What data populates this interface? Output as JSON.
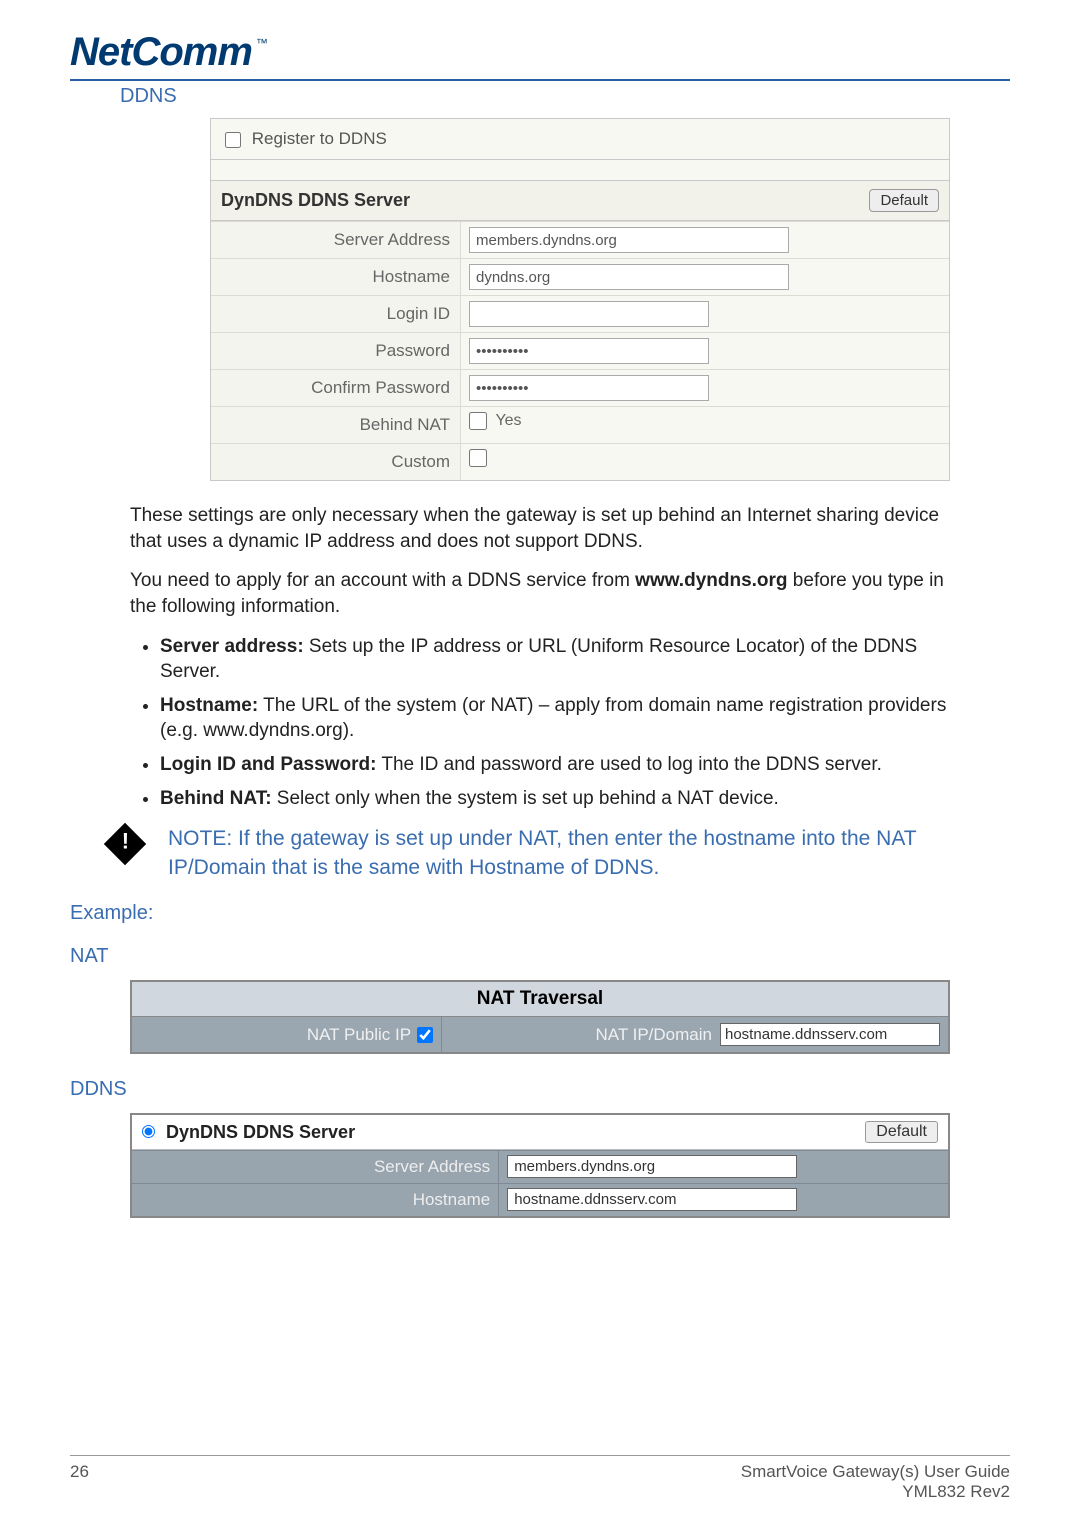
{
  "logo": "NetComm",
  "tm": "™",
  "sections": {
    "ddns_heading": "DDNS",
    "register_label": "Register to DDNS",
    "server_title": "DynDNS DDNS Server",
    "default_btn": "Default",
    "fields": {
      "server_address": {
        "label": "Server Address",
        "value": "members.dyndns.org"
      },
      "hostname": {
        "label": "Hostname",
        "value": "dyndns.org"
      },
      "login_id": {
        "label": "Login ID",
        "value": ""
      },
      "password": {
        "label": "Password",
        "value": "••••••••••"
      },
      "confirm_password": {
        "label": "Confirm Password",
        "value": "••••••••••"
      },
      "behind_nat": {
        "label": "Behind NAT",
        "yes": "Yes"
      },
      "custom": {
        "label": "Custom"
      }
    }
  },
  "para1": "These settings are only necessary when the gateway is set up behind an Internet sharing device that uses a dynamic IP address and does not support DDNS.",
  "para2a": "You need to apply for an account with a DDNS service from ",
  "para2b": "www.dyndns.org",
  "para2c": " before you type in the following information.",
  "bullets": {
    "b1a": "Server address:",
    "b1b": " Sets up the IP address or URL (Uniform Resource Locator) of the DDNS Server.",
    "b2a": "Hostname:",
    "b2b": " The URL of the system (or NAT) – apply from domain name registration providers (e.g. www.dyndns.org).",
    "b3a": "Login ID and Password:",
    "b3b": " The ID and password are used to log into the DDNS server.",
    "b4a": "Behind NAT:",
    "b4b": " Select only when the system is set up behind a NAT device."
  },
  "note_label": "NOTE:",
  "note_text": " If the gateway is set up under NAT, then enter the hostname into the NAT IP/Domain that is the same with Hostname of DDNS.",
  "example_label": "Example:",
  "nat_heading": "NAT",
  "nat_table": {
    "title": "NAT Traversal",
    "left_label": "NAT Public IP",
    "right_label": "NAT IP/Domain",
    "right_value": "hostname.ddnsserv.com"
  },
  "ddns2_heading": "DDNS",
  "ddns2": {
    "title": "DynDNS DDNS Server",
    "default_btn": "Default",
    "server_address": {
      "label": "Server Address",
      "value": "members.dyndns.org"
    },
    "hostname": {
      "label": "Hostname",
      "value": "hostname.ddnsserv.com"
    }
  },
  "footer": {
    "page": "26",
    "guide": "SmartVoice Gateway(s) User Guide",
    "rev": "YML832 Rev2"
  }
}
